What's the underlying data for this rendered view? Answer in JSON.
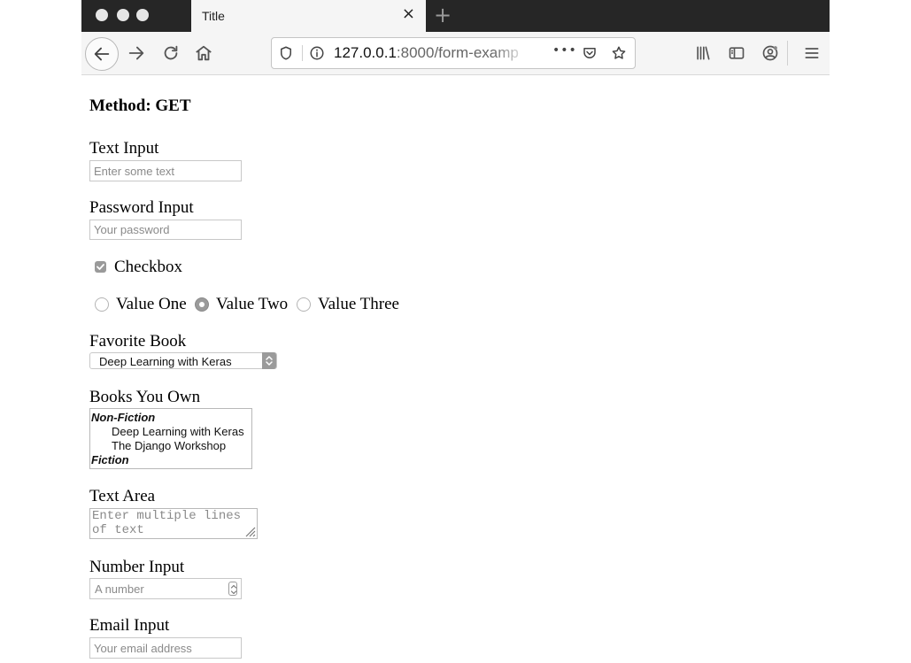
{
  "browser": {
    "tab_title": "Title",
    "tab_close": "×",
    "new_tab": "+",
    "url_host": "127.0.0.1",
    "url_path": ":8000/form-examp",
    "page_actions_more": "•••"
  },
  "form": {
    "method_heading": "Method: GET",
    "text_input": {
      "label": "Text Input",
      "placeholder": "Enter some text"
    },
    "password_input": {
      "label": "Password Input",
      "placeholder": "Your password"
    },
    "checkbox": {
      "label": "Checkbox",
      "checked": true
    },
    "radios": [
      {
        "label": "Value One",
        "selected": false
      },
      {
        "label": "Value Two",
        "selected": true
      },
      {
        "label": "Value Three",
        "selected": false
      }
    ],
    "favorite_book": {
      "label": "Favorite Book",
      "selected": "Deep Learning with Keras"
    },
    "books_you_own": {
      "label": "Books You Own",
      "groups": [
        {
          "label": "Non-Fiction",
          "options": [
            "Deep Learning with Keras",
            "The Django Workshop"
          ]
        },
        {
          "label": "Fiction",
          "options": []
        }
      ]
    },
    "text_area": {
      "label": "Text Area",
      "placeholder_line1": "Enter multiple lines",
      "placeholder_line2": "of text"
    },
    "number_input": {
      "label": "Number Input",
      "placeholder": "A number"
    },
    "email_input": {
      "label": "Email Input",
      "placeholder": "Your email address"
    }
  }
}
